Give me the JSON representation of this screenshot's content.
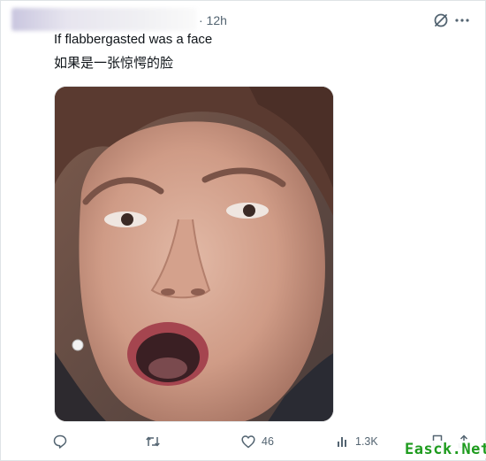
{
  "post": {
    "timestamp": "· 12h",
    "text_en": "If flabbergasted was a face",
    "text_zh": "如果是一张惊愕的脸"
  },
  "actions": {
    "reply_icon": "reply-icon",
    "repost_icon": "repost-icon",
    "like_icon": "heart-icon",
    "like_count": "46",
    "views_icon": "views-icon",
    "views_count": "1.3K",
    "bookmark_icon": "bookmark-icon",
    "share_icon": "share-icon"
  },
  "watermark": "Easck.Net",
  "colors": {
    "muted": "#536471",
    "text": "#0f1419",
    "watermark": "#1e9b1e"
  }
}
